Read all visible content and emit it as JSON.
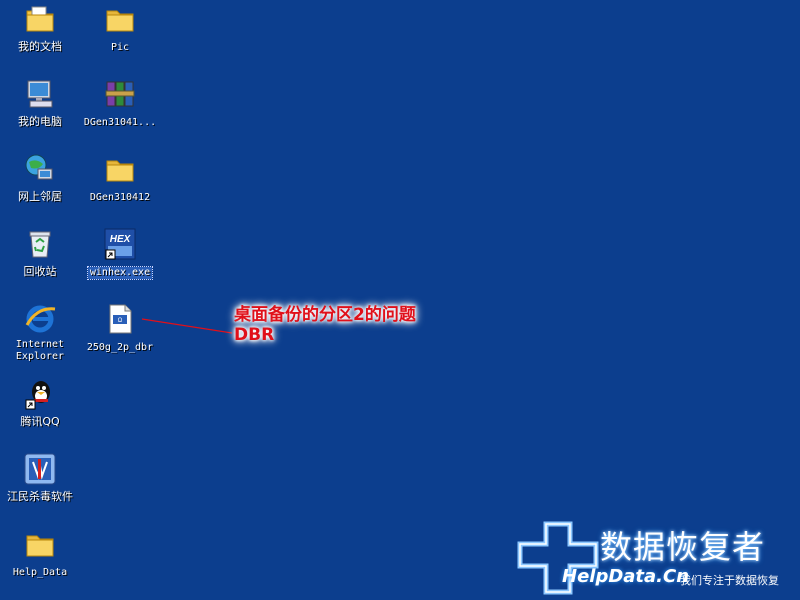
{
  "desktop": {
    "icons": [
      {
        "label": "我的文档",
        "icon": "my-documents-icon"
      },
      {
        "label": "Pic",
        "icon": "folder-icon"
      },
      {
        "label": "我的电脑",
        "icon": "my-computer-icon"
      },
      {
        "label": "DGen31041...",
        "icon": "winrar-archive-icon"
      },
      {
        "label": "网上邻居",
        "icon": "network-places-icon"
      },
      {
        "label": "DGen310412",
        "icon": "folder-icon"
      },
      {
        "label": "回收站",
        "icon": "recycle-bin-icon"
      },
      {
        "label": "winhex.exe",
        "icon": "winhex-icon"
      },
      {
        "label": "Internet\nExplorer",
        "icon": "internet-explorer-icon"
      },
      {
        "label": "250g_2p_dbr",
        "icon": "document-file-icon"
      },
      {
        "label": "腾讯QQ",
        "icon": "qq-penguin-icon"
      },
      {
        "label": "江民杀毒软件",
        "icon": "jiangmin-antivirus-icon"
      },
      {
        "label": "Help_Data",
        "icon": "folder-icon"
      }
    ]
  },
  "annotation": {
    "line1": "桌面备份的分区2的问题",
    "line2": "DBR",
    "color": "#e0101a"
  },
  "branding": {
    "title": "数据恢复者",
    "site": "HelpData.Cn",
    "slogan": "我们专注于数据恢复"
  },
  "colors": {
    "desktop_bg": "#0c3e8e",
    "selection": "#2a5fb8",
    "folder": "#f5c542"
  }
}
